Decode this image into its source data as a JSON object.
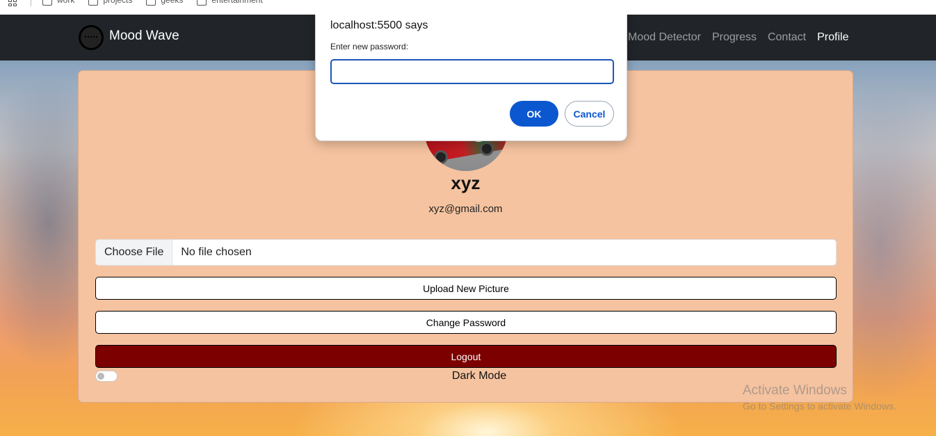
{
  "bookmarks": [
    {
      "label": "work"
    },
    {
      "label": "projects"
    },
    {
      "label": "geeks"
    },
    {
      "label": "entertainment"
    }
  ],
  "navbar": {
    "brand": "Mood Wave",
    "links": [
      {
        "label": "Mood Detector"
      },
      {
        "label": "Progress"
      },
      {
        "label": "Contact"
      },
      {
        "label": "Profile",
        "active": true
      }
    ]
  },
  "profile": {
    "username": "xyz",
    "email": "xyz@gmail.com",
    "file_button": "Choose File",
    "file_status": "No file chosen",
    "upload_label": "Upload New Picture",
    "change_password_label": "Change Password",
    "logout_label": "Logout",
    "dark_mode_label": "Dark Mode",
    "dark_mode_on": false
  },
  "dialog": {
    "title": "localhost:5500 says",
    "message": "Enter new password:",
    "input_value": "",
    "ok_label": "OK",
    "cancel_label": "Cancel"
  },
  "watermark": {
    "title": "Activate Windows",
    "subtitle": "Go to Settings to activate Windows."
  },
  "colors": {
    "navbar_bg": "#212529",
    "card_bg": "#f5c3a0",
    "logout_bg": "#7c0000",
    "dialog_accent": "#0b57d0"
  }
}
